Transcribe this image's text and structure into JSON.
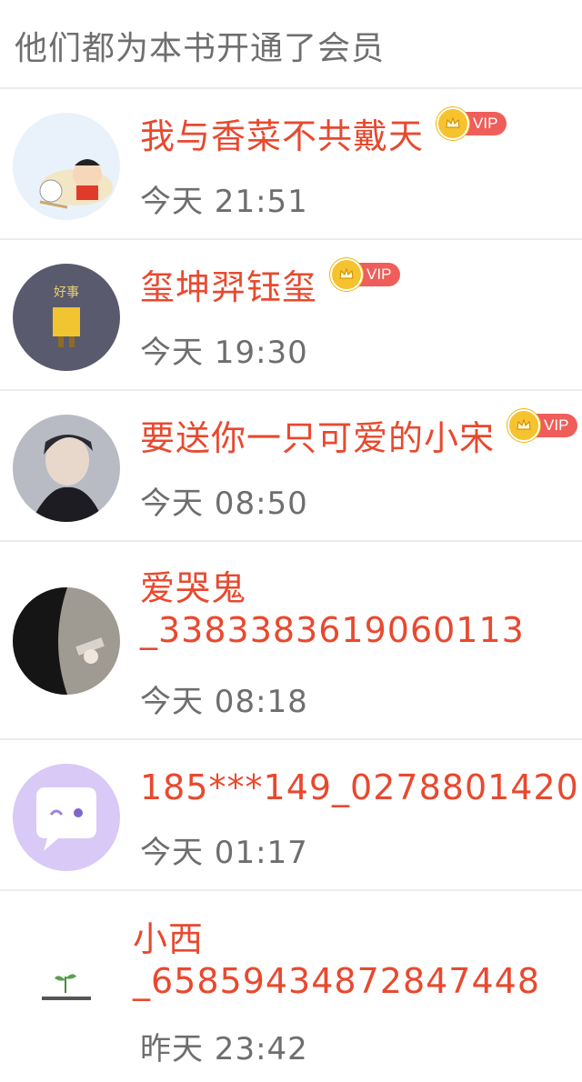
{
  "header": {
    "title": "他们都为本书开通了会员"
  },
  "members": [
    {
      "name": "我与香菜不共戴天",
      "vip": true,
      "vip_label": "VIP",
      "time": "今天 21:51"
    },
    {
      "name": "玺坤羿钰玺",
      "vip": true,
      "vip_label": "VIP",
      "time": "今天 19:30"
    },
    {
      "name": "要送你一只可爱的小宋",
      "vip": true,
      "vip_label": "VIP",
      "time": "今天 08:50"
    },
    {
      "name": "爱哭鬼_3383383619060113",
      "vip": false,
      "time": "今天 08:18"
    },
    {
      "name": "185***149_0278801420",
      "vip": false,
      "time": "今天 01:17"
    },
    {
      "name": "小西_6585943487284744​8",
      "vip": false,
      "time": "昨天 23:42"
    }
  ],
  "colors": {
    "name": "#e8492f",
    "time": "#6e6e6e",
    "header": "#6f6f6f",
    "vip_badge": "#ef5e5a",
    "crown": "#f6c22e"
  }
}
